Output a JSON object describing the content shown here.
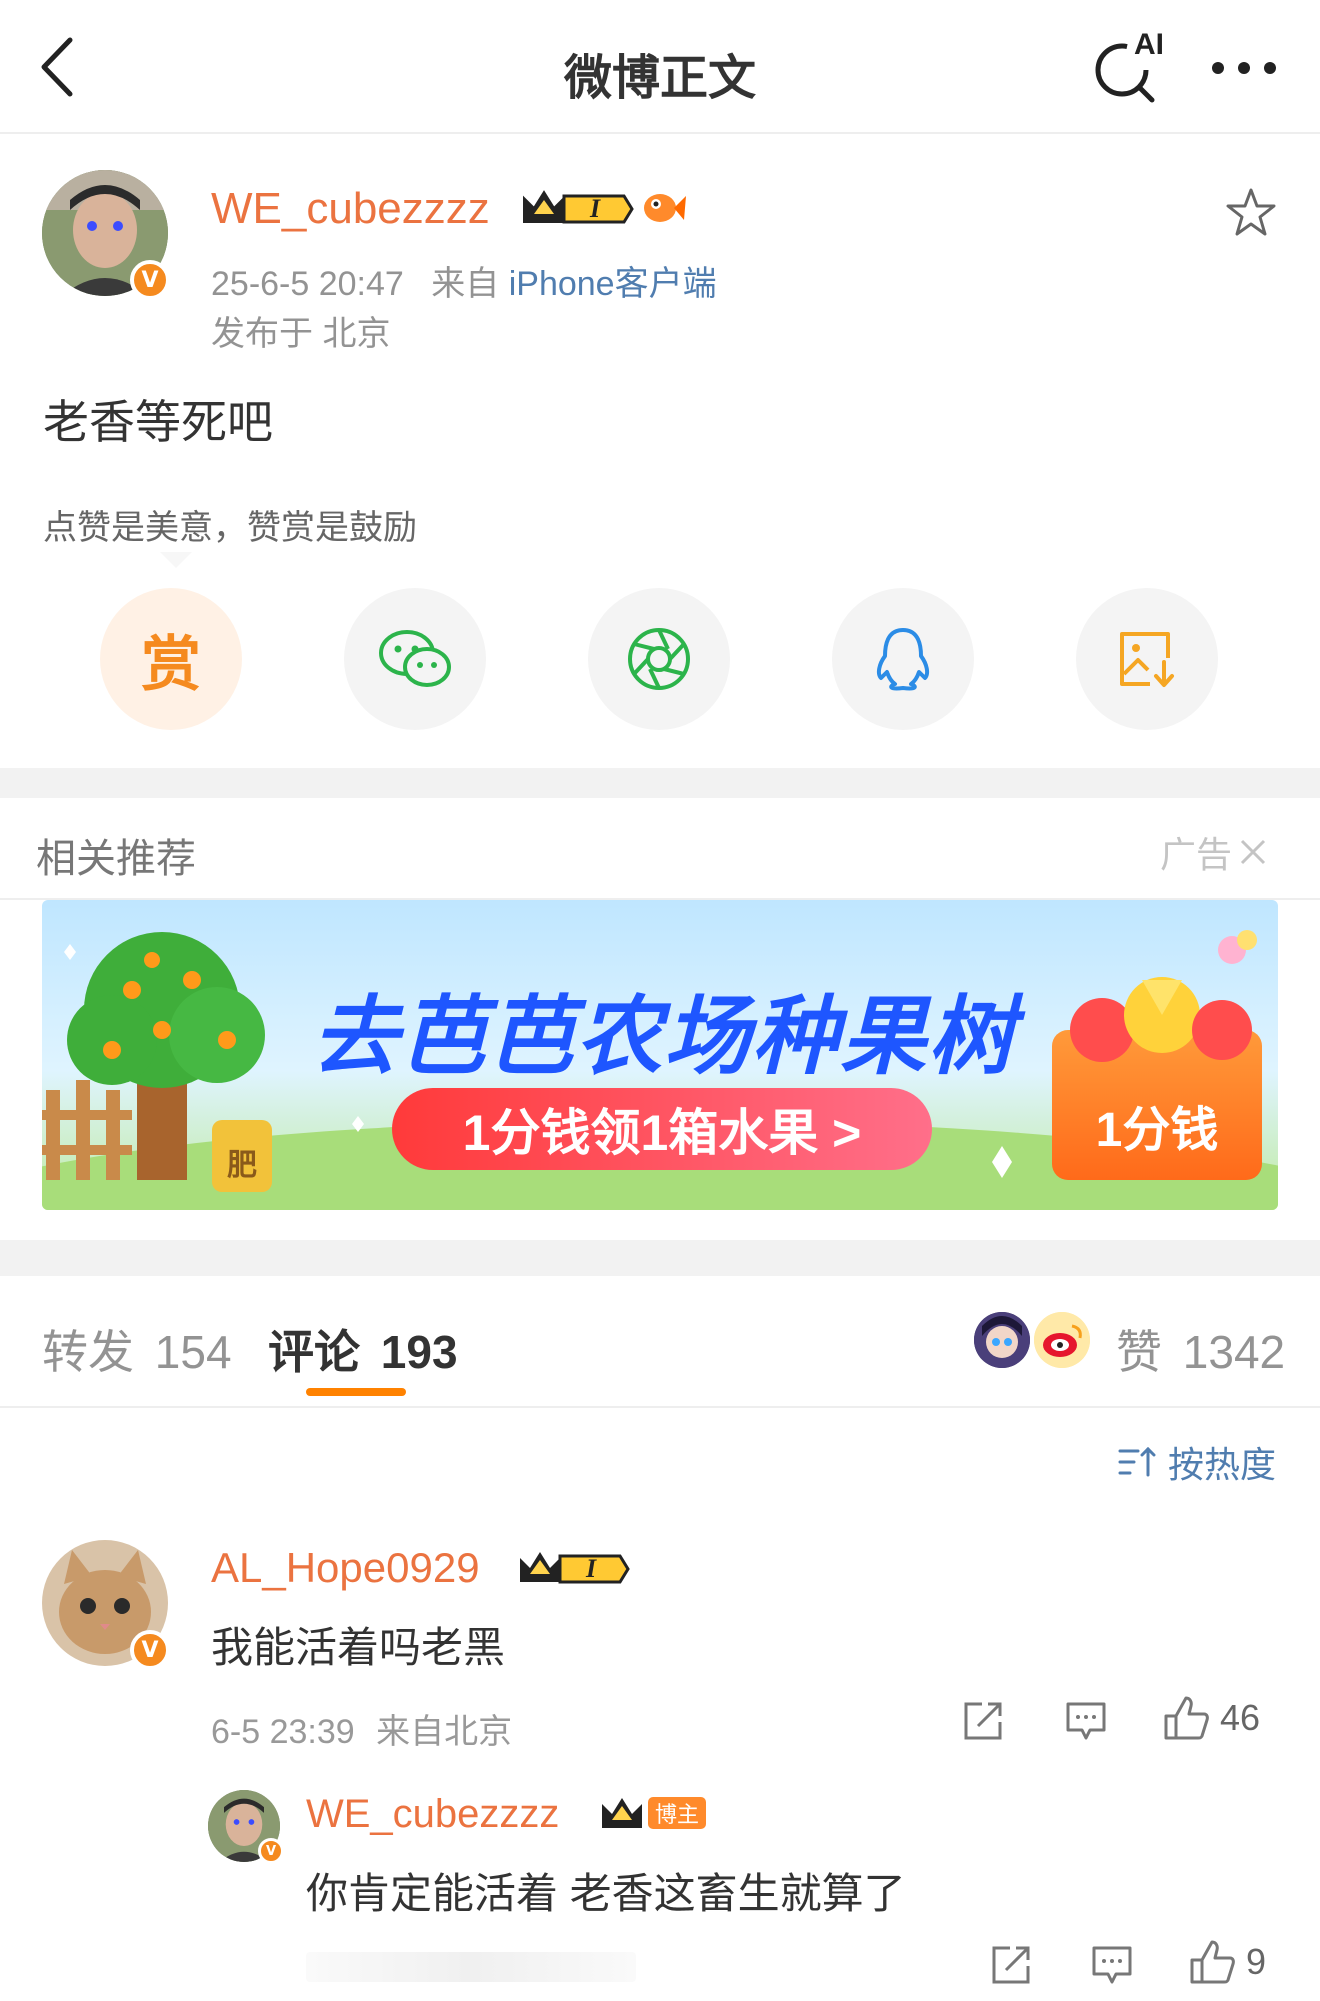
{
  "header": {
    "title": "微博正文",
    "ai_label": "AI"
  },
  "post": {
    "username": "WE_cubezzzz",
    "level": "I",
    "time": "25-6-5 20:47",
    "from_prefix": "来自",
    "source": "iPhone客户端",
    "location": "发布于 北京",
    "content": "老香等死吧",
    "tip": "点赞是美意，赞赏是鼓励",
    "reward_label": "赏"
  },
  "related": {
    "title": "相关推荐",
    "ad_label": "广告"
  },
  "ad": {
    "headline": "去芭芭农场种果树",
    "cta": "1分钱领1箱水果 >",
    "badge": "1分钱",
    "fert": "肥"
  },
  "tabs": {
    "repost_label": "转发",
    "repost_count": "154",
    "comment_label": "评论",
    "comment_count": "193",
    "like_label": "赞",
    "like_count": "1342"
  },
  "sort_label": "按热度",
  "comments": [
    {
      "username": "AL_Hope0929",
      "level": "I",
      "text": "我能活着吗老黑",
      "time": "6-5 23:39",
      "location": "来自北京",
      "likes": "46",
      "reply": {
        "username": "WE_cubezzzz",
        "badge": "博主",
        "text": "你肯定能活着 老香这畜生就算了",
        "likes": "9"
      }
    }
  ],
  "colors": {
    "accent": "#ff8200",
    "name": "#eb7340",
    "link": "#507daf"
  }
}
